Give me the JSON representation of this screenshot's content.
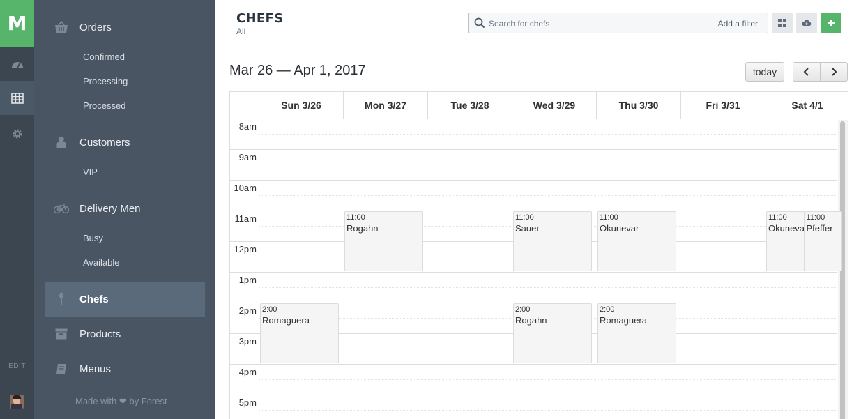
{
  "rail": {
    "logo": "M",
    "edit": "EDIT"
  },
  "sidebar": {
    "orders": "Orders",
    "orders_sub": [
      "Confirmed",
      "Processing",
      "Processed"
    ],
    "customers": "Customers",
    "customers_sub": [
      "VIP"
    ],
    "delivery": "Delivery Men",
    "delivery_sub": [
      "Busy",
      "Available"
    ],
    "chefs": "Chefs",
    "products": "Products",
    "menus": "Menus",
    "made_with": "Made with",
    "by_forest": "by Forest"
  },
  "header": {
    "title": "CHEFS",
    "subtitle": "All",
    "search_placeholder": "Search for chefs",
    "add_filter": "Add a filter"
  },
  "calendar": {
    "range": "Mar 26 — Apr 1, 2017",
    "today": "today",
    "days": [
      "Sun 3/26",
      "Mon 3/27",
      "Tue 3/28",
      "Wed 3/29",
      "Thu 3/30",
      "Fri 3/31",
      "Sat 4/1"
    ],
    "hours": [
      "8am",
      "9am",
      "10am",
      "11am",
      "12pm",
      "1pm",
      "2pm",
      "3pm",
      "4pm",
      "5pm"
    ],
    "events": [
      {
        "time": "11:00",
        "name": "Rogahn",
        "day": "Mon 3/27"
      },
      {
        "time": "11:00",
        "name": "Sauer",
        "day": "Wed 3/29"
      },
      {
        "time": "11:00",
        "name": "Okunevar",
        "day": "Thu 3/30"
      },
      {
        "time": "11:00",
        "name": "Okunevar",
        "day": "Sat 4/1"
      },
      {
        "time": "11:00",
        "name": "Pfeffer",
        "day": "Sat 4/1"
      },
      {
        "time": "2:00",
        "name": "Romaguera",
        "day": "Sun 3/26"
      },
      {
        "time": "2:00",
        "name": "Rogahn",
        "day": "Wed 3/29"
      },
      {
        "time": "2:00",
        "name": "Romaguera",
        "day": "Thu 3/30"
      }
    ]
  },
  "colors": {
    "accent": "#56b46b",
    "sidebar": "#4a5563",
    "rail": "#3c4651"
  }
}
